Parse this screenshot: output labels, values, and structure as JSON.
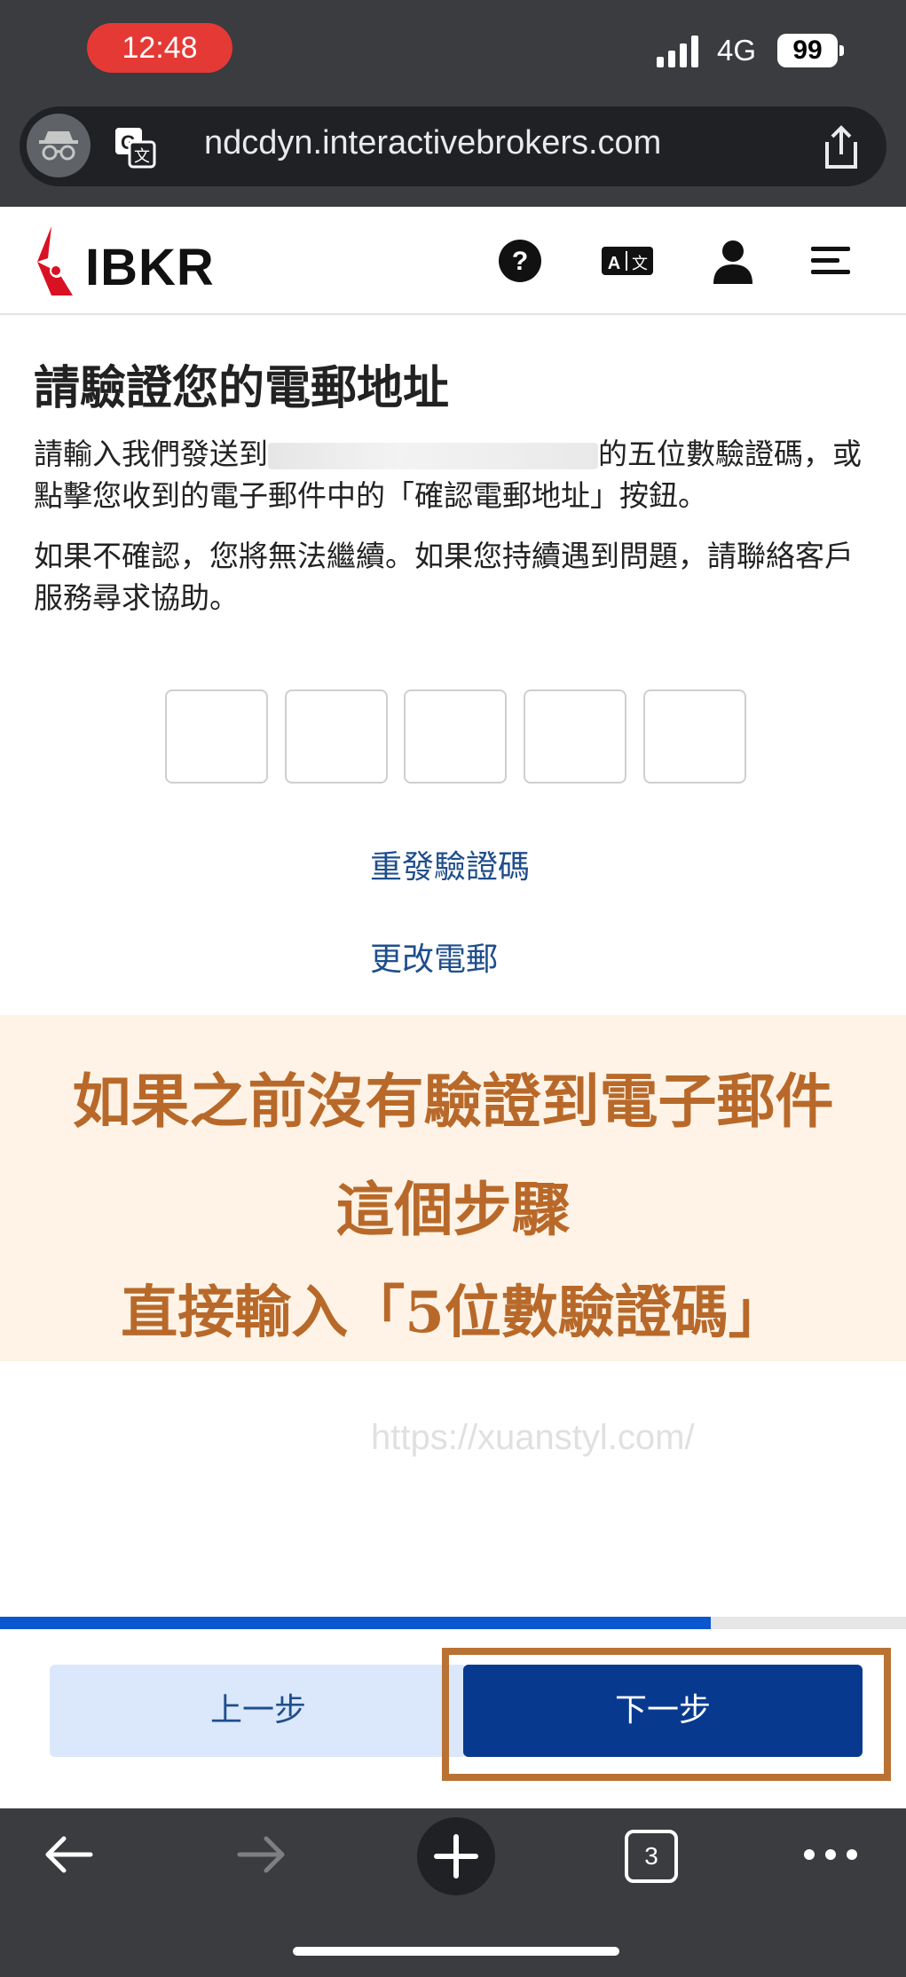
{
  "status_bar": {
    "time": "12:48",
    "network": "4G",
    "battery": "99"
  },
  "browser": {
    "url": "ndcdyn.interactivebrokers.com",
    "tab_count": "3"
  },
  "site": {
    "logo_text": "IBKR"
  },
  "page": {
    "title": "請驗證您的電郵地址",
    "instruction_prefix": "請輸入我們發送到",
    "instruction_suffix": "的五位數驗證碼，或",
    "instruction_line2": "點擊您收到的電子郵件中的「確認電郵地址」按鈕。",
    "warning_line1": "如果不確認，您將無法繼續。如果您持續遇到問題，請聯絡客戶",
    "warning_line2": "服務尋求協助。",
    "resend_link": "重發驗證碼",
    "change_email_link": "更改電郵"
  },
  "banner": {
    "line1": "如果之前沒有驗證到電子郵件",
    "line2": "這個步驟",
    "line3": "直接輸入「5位數驗證碼」"
  },
  "watermark": "https://xuanstyl.com/",
  "progress": {
    "fraction": 0.785
  },
  "buttons": {
    "prev": "上一步",
    "next": "下一步"
  },
  "colors": {
    "primary": "#073a8f",
    "link": "#1f4e8c",
    "accent": "#b97234",
    "banner_bg": "#fef3e6",
    "progress": "#0b57d0"
  }
}
